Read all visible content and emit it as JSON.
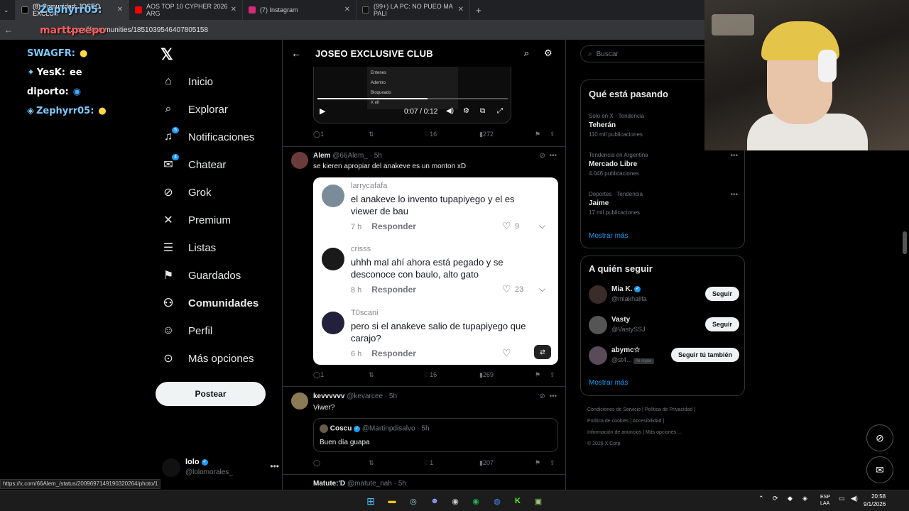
{
  "browser": {
    "tabs": [
      {
        "label": "(8) Comunidad: JOSEO EXCLUS",
        "icon": "x-icon",
        "color": "#000000"
      },
      {
        "label": "AOS TOP 10 CYPHER 2026 ARG",
        "icon": "youtube-icon",
        "color": "#ff0000"
      },
      {
        "label": "(7) Instagram",
        "icon": "instagram-icon",
        "color": "#d62976"
      },
      {
        "label": "(99+) LA PC: NO PUEO MA PALI",
        "icon": "tiktok-icon",
        "color": "#111111"
      }
    ],
    "url": "x.com/i/communities/1851039546407805158",
    "status_url": "https://x.com/66Alem_/status/2009697149190320264/photo/1"
  },
  "overlay": {
    "top_name": "Zephyrr05:",
    "second_name": "marttpeepo",
    "chat": [
      {
        "user": "SWAGFR:",
        "msg": ""
      },
      {
        "user": "YesK:",
        "msg": "ee"
      },
      {
        "user": "diporto:",
        "msg": ""
      },
      {
        "user": "Zephyrr05:",
        "msg": ""
      }
    ]
  },
  "sidebar": {
    "items": [
      {
        "label": "Inicio",
        "icon": "⌂",
        "name": "home"
      },
      {
        "label": "Explorar",
        "icon": "⌕",
        "name": "explore"
      },
      {
        "label": "Notificaciones",
        "icon": "🔔",
        "name": "notifications",
        "badge": "5"
      },
      {
        "label": "Chatear",
        "icon": "✉",
        "name": "chat",
        "badge": "4"
      },
      {
        "label": "Grok",
        "icon": "⊘",
        "name": "grok"
      },
      {
        "label": "Premium",
        "icon": "𝕏",
        "name": "premium"
      },
      {
        "label": "Listas",
        "icon": "☰",
        "name": "lists"
      },
      {
        "label": "Guardados",
        "icon": "⚑",
        "name": "bookmarks"
      },
      {
        "label": "Comunidades",
        "icon": "👥",
        "name": "communities",
        "bold": true
      },
      {
        "label": "Perfil",
        "icon": "👤",
        "name": "profile"
      },
      {
        "label": "Más opciones",
        "icon": "⋯",
        "name": "more"
      }
    ],
    "post_label": "Postear",
    "account": {
      "name": "lolo",
      "handle": "@lolomorales_"
    }
  },
  "main": {
    "title": "JOSEO EXCLUSIVE CLUB",
    "video": {
      "menu_items": [
        "Entenes",
        "Adentro",
        "Bloqueado",
        "X ell",
        "Mensaje..."
      ],
      "time": "0:07 / 0:12",
      "progress": 0.58
    },
    "post1_actions": {
      "replies": "1",
      "likes": "16",
      "views": "272"
    },
    "post2": {
      "name": "Alem",
      "handle": "@66Alem_ · 5h",
      "text": "se kieren apropiar del anakeve es un monton xD",
      "comments": [
        {
          "user": "larrycafafa",
          "text": "el anakeve lo invento tupapiyego y el es viewer de bau",
          "time": "7 h",
          "reply": "Responder",
          "likes": "9"
        },
        {
          "user": "crisss",
          "text": "uhhh mal ahí ahora está pegado y se desconoce con baulo, alto gato",
          "time": "8 h",
          "reply": "Responder",
          "likes": "23"
        },
        {
          "user": "T0scani",
          "text": "pero si el anakeve salio de tupapiyego que carajo?",
          "time": "6 h",
          "reply": "Responder",
          "likes": ""
        }
      ],
      "actions": {
        "replies": "1",
        "likes": "16",
        "views": "269"
      }
    },
    "post3": {
      "name": "kevvvvvv",
      "handle": "@kevarcee · 5h",
      "text": "Viwer?",
      "quote": {
        "name": "Coscu",
        "handle": "@Martinpdisalvo · 5h",
        "text": "Buen día guapa"
      },
      "actions": {
        "replies": "",
        "likes": "1",
        "views": "207"
      }
    },
    "post4": {
      "name": "Matute:'D",
      "handle": "@matute_nah · 5h"
    }
  },
  "right": {
    "search_placeholder": "Buscar",
    "trends_title": "Qué está pasando",
    "trends": [
      {
        "context": "Solo en X · Tendencia",
        "name": "Teherán",
        "count": "110 mil publicaciones"
      },
      {
        "context": "Tendencia en Argentina",
        "name": "Mercado Libre",
        "count": "4.046 publicaciones"
      },
      {
        "context": "Deportes · Tendencia",
        "name": "Jaime",
        "count": "17 mil publicaciones"
      }
    ],
    "show_more": "Mostrar más",
    "follow_title": "A quién seguir",
    "follow": [
      {
        "name": "Mia K.",
        "handle": "@miakhalifa",
        "button": "Seguir"
      },
      {
        "name": "Vasty",
        "handle": "@VastySSJ",
        "button": "Seguir"
      },
      {
        "name": "abymc☆",
        "handle": "@st4...",
        "tag": "Te sigue",
        "button": "Seguir tú también"
      }
    ],
    "footer": [
      "Condiciones de Servicio",
      "Política de Privacidad",
      "Política de cookies",
      "Accesibilidad",
      "Información de anuncios",
      "Más opciones ...",
      "© 2026 X Corp."
    ]
  },
  "taskbar": {
    "lang": "ESP",
    "lang2": "LAA",
    "time": "20:58",
    "date": "9/1/2026"
  }
}
